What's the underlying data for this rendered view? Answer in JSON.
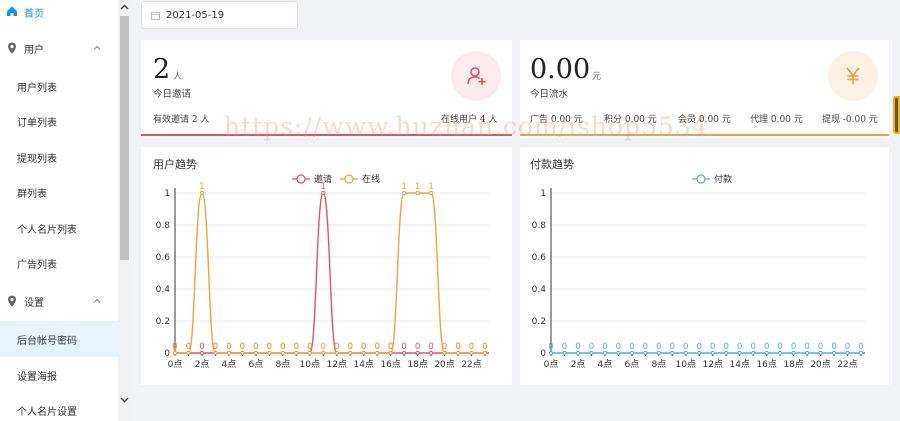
{
  "sidebar": {
    "home": "首页",
    "groups": [
      {
        "label": "用户",
        "items": [
          "用户列表",
          "订单列表",
          "提现列表",
          "群列表",
          "个人名片列表",
          "广告列表"
        ]
      },
      {
        "label": "设置",
        "items": [
          "后台帐号密码",
          "设置海报",
          "个人名片设置"
        ]
      }
    ],
    "active_item": "后台帐号密码"
  },
  "date_picker": {
    "value": "2021-05-19"
  },
  "card_invites": {
    "value": "2",
    "unit": "人",
    "label": "今日邀请",
    "stats": [
      "有效邀请 2 人",
      "在线用户 4 人"
    ],
    "icon": "add-user-icon",
    "accent": "#e6505f"
  },
  "card_flow": {
    "value": "0.00",
    "unit": "元",
    "label": "今日流水",
    "stats": [
      "广告 0.00 元",
      "积分 0.00 元",
      "会员 0.00 元",
      "代理 0.00 元",
      "提现 -0.00 元"
    ],
    "icon": "yuan-icon",
    "accent": "#f0a040"
  },
  "watermark": "https://www.huzhan.com/ishop5534",
  "chart_data": [
    {
      "type": "line",
      "title": "用户趋势",
      "x": [
        "0点",
        "1点",
        "2点",
        "3点",
        "4点",
        "5点",
        "6点",
        "7点",
        "8点",
        "9点",
        "10点",
        "11点",
        "12点",
        "13点",
        "14点",
        "15点",
        "16点",
        "17点",
        "18点",
        "19点",
        "20点",
        "21点",
        "22点",
        "23点"
      ],
      "xticks": [
        "0点",
        "2点",
        "4点",
        "6点",
        "8点",
        "10点",
        "12点",
        "14点",
        "16点",
        "18点",
        "20点",
        "22点"
      ],
      "ylim": [
        0,
        1
      ],
      "yticks": [
        "0",
        "0.2",
        "0.4",
        "0.6",
        "0.8",
        "1"
      ],
      "series": [
        {
          "name": "邀请",
          "color": "#e6505f",
          "values": [
            0,
            0,
            0,
            0,
            0,
            0,
            0,
            0,
            0,
            0,
            0,
            1,
            0,
            0,
            0,
            0,
            0,
            0,
            0,
            0,
            0,
            0,
            0,
            0
          ]
        },
        {
          "name": "在线",
          "color": "#f0a040",
          "values": [
            0,
            0,
            1,
            0,
            0,
            0,
            0,
            0,
            0,
            0,
            0,
            0,
            0,
            0,
            0,
            0,
            0,
            1,
            1,
            1,
            0,
            0,
            0,
            0
          ]
        }
      ],
      "legend": "top"
    },
    {
      "type": "line",
      "title": "付款趋势",
      "x": [
        "0点",
        "1点",
        "2点",
        "3点",
        "4点",
        "5点",
        "6点",
        "7点",
        "8点",
        "9点",
        "10点",
        "11点",
        "12点",
        "13点",
        "14点",
        "15点",
        "16点",
        "17点",
        "18点",
        "19点",
        "20点",
        "21点",
        "22点",
        "23点"
      ],
      "xticks": [
        "0点",
        "2点",
        "4点",
        "6点",
        "8点",
        "10点",
        "12点",
        "14点",
        "16点",
        "18点",
        "20点",
        "22点"
      ],
      "ylim": [
        0,
        1
      ],
      "yticks": [
        "0",
        "0.2",
        "0.4",
        "0.6",
        "0.8",
        "1"
      ],
      "series": [
        {
          "name": "付款",
          "color": "#5aa8e0",
          "values": [
            0,
            0,
            0,
            0,
            0,
            0,
            0,
            0,
            0,
            0,
            0,
            0,
            0,
            0,
            0,
            0,
            0,
            0,
            0,
            0,
            0,
            0,
            0,
            0
          ]
        }
      ],
      "legend": "top"
    }
  ]
}
